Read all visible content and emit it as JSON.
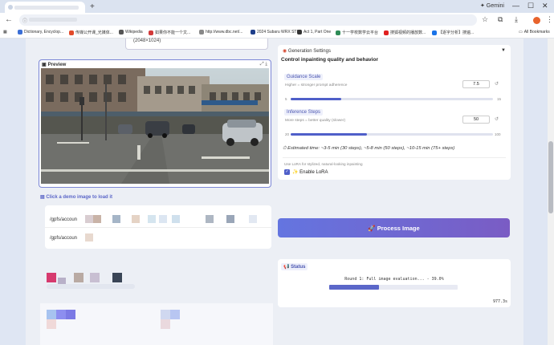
{
  "browser": {
    "new_tab": "+",
    "gemini": "✦ Gemini",
    "minimize": "—",
    "maximize": "☐",
    "close": "✕",
    "back": "←",
    "avatar_letter": "",
    "bookmarks": [
      {
        "label": "Dictionary, Encyclop...",
        "color": "#3b6fd6"
      },
      {
        "label": "传媒公开课_光媒体...",
        "color": "#e24b2b"
      },
      {
        "label": "Wikipedia",
        "color": "#555555"
      },
      {
        "label": "如果你不能一个文...",
        "color": "#d23a3a"
      },
      {
        "label": "http://www.dbc.net/...",
        "color": "#888888"
      },
      {
        "label": "2024 Subaru WRX STI...",
        "color": "#1e3e8a"
      },
      {
        "label": "Act 1, Part One",
        "color": "#333333"
      },
      {
        "label": "十一学校数学云平台",
        "color": "#2e8b57"
      },
      {
        "label": "搜狐视频的播放数...",
        "color": "#e02020"
      },
      {
        "label": "【逐字分析】搜遍...",
        "color": "#1a73e8"
      }
    ],
    "all_bookmarks": "All Bookmarks"
  },
  "resolution_text": "(2048×1024)",
  "preview": {
    "label": "Preview",
    "icons": "⤢ ⤓"
  },
  "demo": {
    "label": "Click a demo image to load it",
    "rows": [
      "/gpfs/accoun",
      "/gpfs/accoun"
    ]
  },
  "generation": {
    "header": "Generation Settings",
    "subtitle": "Control inpainting quality and behavior",
    "collapse": "▼",
    "guidance": {
      "label": "Guidance Scale",
      "hint": "Higher = stronger prompt adherence",
      "value": "7.5",
      "min": "5",
      "max": "15",
      "fraction": 0.25
    },
    "steps": {
      "label": "Inference Steps",
      "hint": "More steps = better quality (slower)",
      "value": "50",
      "min": "20",
      "max": "100",
      "fraction": 0.375
    },
    "reset": "↺",
    "estimate": "Estimated time: ~3-5 min (30 steps), ~5-8 min (50 steps), ~10-15 min (75+ steps)",
    "lora_hint": "Use LoRA for stylized, natural-looking inpainting",
    "lora_label": "✨ Enable LoRA",
    "check": "✓"
  },
  "process_button": "🚀 Process Image",
  "status": {
    "label": "📢 Status",
    "text": "Round 1: Full image evaluation... - 39.0%",
    "progress": 0.39,
    "elapsed": "977.3s"
  },
  "colors": {
    "accent": "#4f5fc9",
    "button_gradient_start": "#6475e0",
    "button_gradient_end": "#7a5cc4"
  }
}
